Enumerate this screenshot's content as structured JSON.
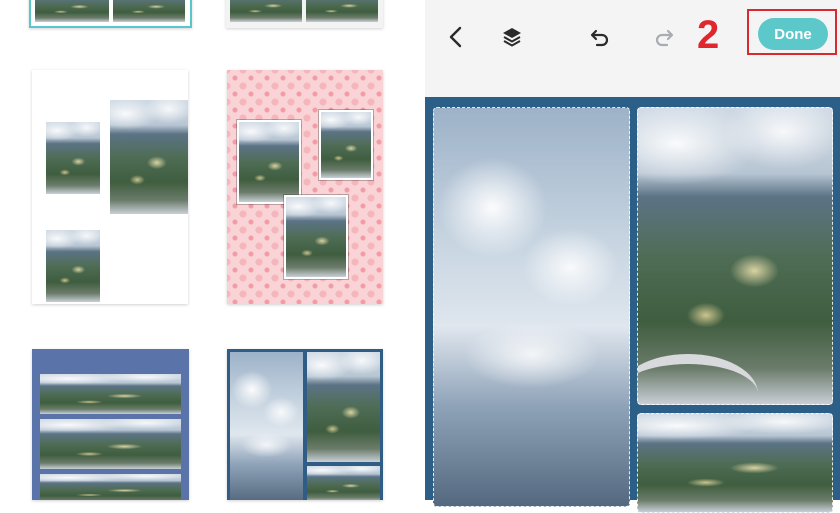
{
  "toolbar": {
    "done_label": "Done",
    "step_number": "2",
    "icons": {
      "back": "chevron-left-icon",
      "layers": "layers-icon",
      "undo": "undo-icon",
      "redo": "redo-icon"
    }
  },
  "colors": {
    "accent": "#5cc8c9",
    "highlight": "#d82a2e",
    "canvas_bg": "#2b5f87",
    "selected_border": "#58c7cc"
  },
  "templates": [
    {
      "name": "top-a",
      "selected": true
    },
    {
      "name": "top-b",
      "selected": false
    },
    {
      "name": "white-three-photos",
      "selected": false
    },
    {
      "name": "pink-damask-three-photos",
      "selected": false
    },
    {
      "name": "blue-strips",
      "selected": false
    },
    {
      "name": "blue-grid",
      "selected": false
    }
  ]
}
